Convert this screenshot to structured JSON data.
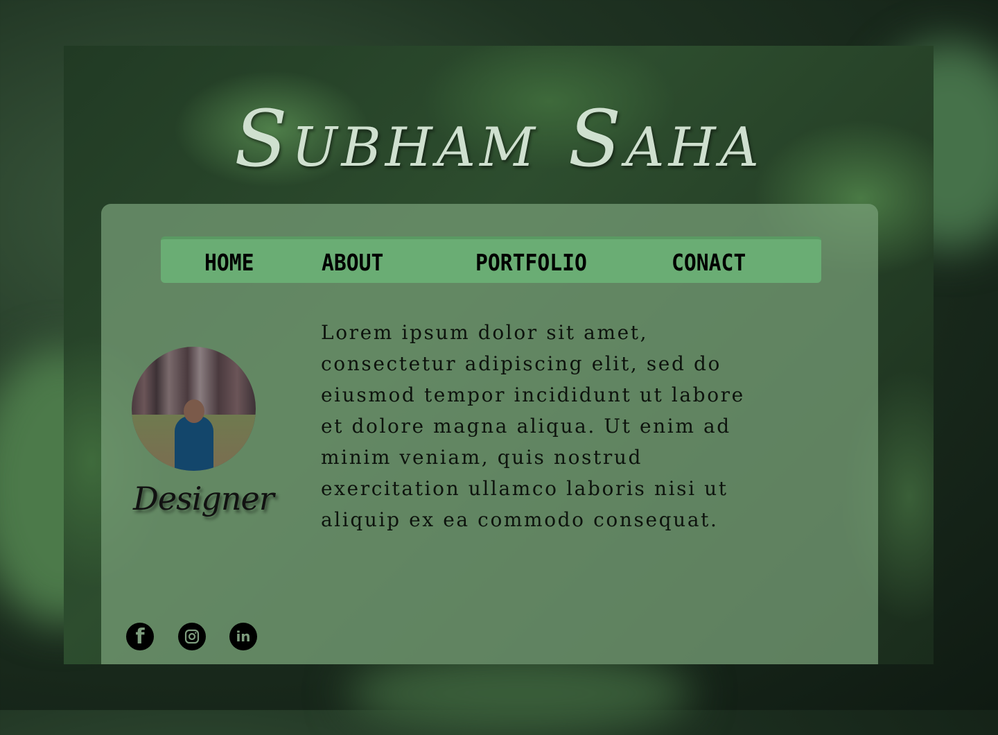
{
  "header": {
    "title": "Subham Saha"
  },
  "nav": {
    "items": [
      {
        "label": "HOME"
      },
      {
        "label": "ABOUT"
      },
      {
        "label": "PORTFOLIO"
      },
      {
        "label": "CONACT"
      }
    ]
  },
  "profile": {
    "role": "Designer"
  },
  "bio": {
    "text": "Lorem ipsum dolor sit amet, consectetur adipiscing elit, sed do eiusmod tempor incididunt ut labore et dolore magna aliqua. Ut enim ad minim veniam, quis nostrud exercitation ullamco laboris nisi ut aliquip ex ea commodo consequat."
  },
  "social": [
    {
      "icon": "facebook-icon"
    },
    {
      "icon": "instagram-icon"
    },
    {
      "icon": "linkedin-icon"
    }
  ],
  "colors": {
    "nav": "#6aad74",
    "panel": "#789f78"
  }
}
